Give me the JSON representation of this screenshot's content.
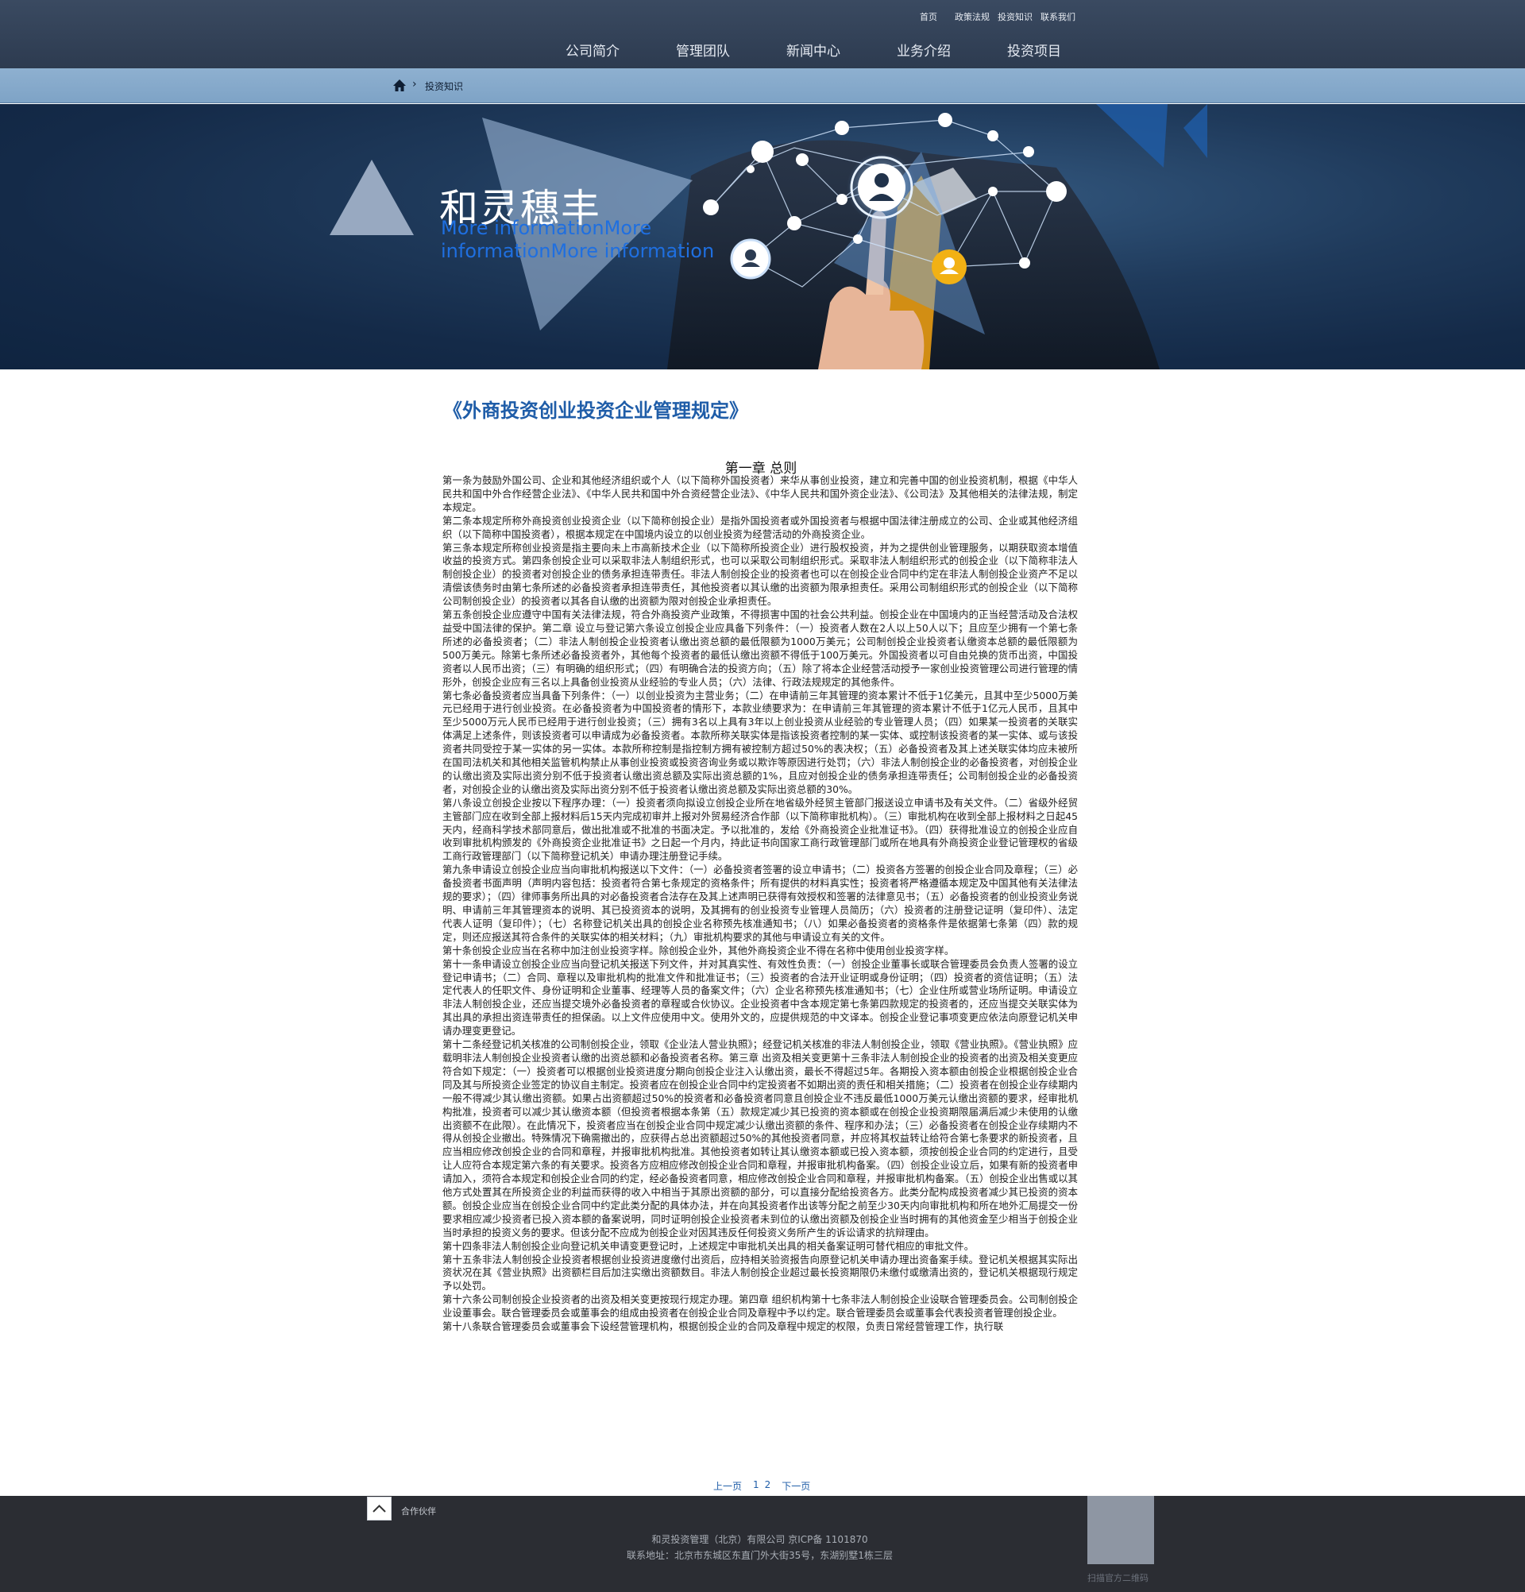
{
  "header": {
    "top_links": [
      "首页",
      "政策法规",
      "投资知识",
      "联系我们"
    ],
    "nav": [
      "公司简介",
      "管理团队",
      "新闻中心",
      "业务介绍",
      "投资项目"
    ]
  },
  "breadcrumb": {
    "current": "投资知识"
  },
  "banner": {
    "brand": "和灵穗丰",
    "subtitle": "More informationMore informationMore information"
  },
  "article": {
    "title": "《外商投资创业投资企业管理规定》",
    "chapter": "第一章 总则",
    "paragraphs": [
      "第一条为鼓励外国公司、企业和其他经济组织或个人（以下简称外国投资者）来华从事创业投资，建立和完善中国的创业投资机制，根据《中华人民共和国中外合作经营企业法》、《中华人民共和国中外合资经营企业法》、《中华人民共和国外资企业法》、《公司法》及其他相关的法律法规，制定本规定。",
      "第二条本规定所称外商投资创业投资企业（以下简称创投企业）是指外国投资者或外国投资者与根据中国法律注册成立的公司、企业或其他经济组织（以下简称中国投资者），根据本规定在中国境内设立的以创业投资为经营活动的外商投资企业。",
      "第三条本规定所称创业投资是指主要向未上市高新技术企业（以下简称所投资企业）进行股权投资，并为之提供创业管理服务，以期获取资本增值收益的投资方式。第四条创投企业可以采取非法人制组织形式，也可以采取公司制组织形式。采取非法人制组织形式的创投企业（以下简称非法人制创投企业）的投资者对创投企业的债务承担连带责任。非法人制创投企业的投资者也可以在创投企业合同中约定在非法人制创投企业资产不足以清偿该债务时由第七条所述的必备投资者承担连带责任，其他投资者以其认缴的出资额为限承担责任。采用公司制组织形式的创投企业（以下简称公司制创投企业）的投资者以其各自认缴的出资额为限对创投企业承担责任。",
      "第五条创投企业应遵守中国有关法律法规，符合外商投资产业政策，不得损害中国的社会公共利益。创投企业在中国境内的正当经营活动及合法权益受中国法律的保护。第二章 设立与登记第六条设立创投企业应具备下列条件：（一）投资者人数在2人以上50人以下；且应至少拥有一个第七条所述的必备投资者；（二）非法人制创投企业投资者认缴出资总额的最低限额为1000万美元；公司制创投企业投资者认缴资本总额的最低限额为500万美元。除第七条所述必备投资者外，其他每个投资者的最低认缴出资额不得低于100万美元。外国投资者以可自由兑换的货币出资，中国投资者以人民币出资；（三）有明确的组织形式；（四）有明确合法的投资方向；（五）除了将本企业经营活动授予一家创业投资管理公司进行管理的情形外，创投企业应有三名以上具备创业投资从业经验的专业人员；（六）法律、行政法规规定的其他条件。",
      "第七条必备投资者应当具备下列条件：（一）以创业投资为主营业务；（二）在申请前三年其管理的资本累计不低于1亿美元，且其中至少5000万美元已经用于进行创业投资。在必备投资者为中国投资者的情形下，本款业绩要求为：在申请前三年其管理的资本累计不低于1亿元人民币，且其中至少5000万元人民币已经用于进行创业投资；（三）拥有3名以上具有3年以上创业投资从业经验的专业管理人员；（四）如果某一投资者的关联实体满足上述条件，则该投资者可以申请成为必备投资者。本款所称关联实体是指该投资者控制的某一实体、或控制该投资者的某一实体、或与该投资者共同受控于某一实体的另一实体。本款所称控制是指控制方拥有被控制方超过50%的表决权；（五）必备投资者及其上述关联实体均应未被所在国司法机关和其他相关监管机构禁止从事创业投资或投资咨询业务或以欺诈等原因进行处罚；（六）非法人制创投企业的必备投资者，对创投企业的认缴出资及实际出资分别不低于投资者认缴出资总额及实际出资总额的1%，且应对创投企业的债务承担连带责任；公司制创投企业的必备投资者，对创投企业的认缴出资及实际出资分别不低于投资者认缴出资总额及实际出资总额的30%。",
      "第八条设立创投企业按以下程序办理：（一）投资者须向拟设立创投企业所在地省级外经贸主管部门报送设立申请书及有关文件。（二）省级外经贸主管部门应在收到全部上报材料后15天内完成初审并上报对外贸易经济合作部（以下简称审批机构）。（三）审批机构在收到全部上报材料之日起45天内，经商科学技术部同意后，做出批准或不批准的书面决定。予以批准的，发给《外商投资企业批准证书》。（四）获得批准设立的创投企业应自收到审批机构颁发的《外商投资企业批准证书》之日起一个月内，持此证书向国家工商行政管理部门或所在地具有外商投资企业登记管理权的省级工商行政管理部门（以下简称登记机关）申请办理注册登记手续。",
      "第九条申请设立创投企业应当向审批机构报送以下文件：（一）必备投资者签署的设立申请书；（二）投资各方签署的创投企业合同及章程；（三）必备投资者书面声明（声明内容包括：投资者符合第七条规定的资格条件；所有提供的材料真实性；投资者将严格遵循本规定及中国其他有关法律法规的要求）；（四）律师事务所出具的对必备投资者合法存在及其上述声明已获得有效授权和签署的法律意见书；（五）必备投资者的创业投资业务说明、申请前三年其管理资本的说明、其已投资资本的说明，及其拥有的创业投资专业管理人员简历；（六）投资者的注册登记证明（复印件）、法定代表人证明（复印件）；（七）名称登记机关出具的创投企业名称预先核准通知书；（八）如果必备投资者的资格条件是依据第七条第（四）款的规定，则还应报送其符合条件的关联实体的相关材料；（九）审批机构要求的其他与申请设立有关的文件。",
      "第十条创投企业应当在名称中加注创业投资字样。除创投企业外，其他外商投资企业不得在名称中使用创业投资字样。",
      "第十一条申请设立创投企业应当向登记机关报送下列文件，并对其真实性、有效性负责：（一）创投企业董事长或联合管理委员会负责人签署的设立登记申请书；（二）合同、章程以及审批机构的批准文件和批准证书；（三）投资者的合法开业证明或身份证明；（四）投资者的资信证明；（五）法定代表人的任职文件、身份证明和企业董事、经理等人员的备案文件；（六）企业名称预先核准通知书；（七）企业住所或营业场所证明。申请设立非法人制创投企业，还应当提交境外必备投资者的章程或合伙协议。企业投资者中含本规定第七条第四款规定的投资者的，还应当提交关联实体为其出具的承担出资连带责任的担保函。以上文件应使用中文。使用外文的，应提供规范的中文译本。创投企业登记事项变更应依法向原登记机关申请办理变更登记。",
      "第十二条经登记机关核准的公司制创投企业，领取《企业法人营业执照》；经登记机关核准的非法人制创投企业，领取《营业执照》。《营业执照》应载明非法人制创投企业投资者认缴的出资总额和必备投资者名称。第三章 出资及相关变更第十三条非法人制创投企业的投资者的出资及相关变更应符合如下规定：（一）投资者可以根据创业投资进度分期向创投企业注入认缴出资，最长不得超过5年。各期投入资本额由创投企业根据创投企业合同及其与所投资企业签定的协议自主制定。投资者应在创投企业合同中约定投资者不如期出资的责任和相关措施；（二）投资者在创投企业存续期内一般不得减少其认缴出资额。如果占出资额超过50%的投资者和必备投资者同意且创投企业不违反最低1000万美元认缴出资额的要求，经审批机构批准，投资者可以减少其认缴资本额（但投资者根据本条第（五）款规定减少其已投资的资本额或在创投企业投资期限届满后减少未使用的认缴出资额不在此限）。在此情况下，投资者应当在创投企业合同中规定减少认缴出资额的条件、程序和办法；（三）必备投资者在创投企业存续期内不得从创投企业撤出。特殊情况下确需撤出的，应获得占总出资额超过50%的其他投资者同意，并应将其权益转让给符合第七条要求的新投资者，且应当相应修改创投企业的合同和章程，并报审批机构批准。其他投资者如转让其认缴资本额或已投入资本额，须按创投企业合同的约定进行，且受让人应符合本规定第六条的有关要求。投资各方应相应修改创投企业合同和章程，并报审批机构备案。（四）创投企业设立后，如果有新的投资者申请加入，须符合本规定和创投企业合同的约定，经必备投资者同意，相应修改创投企业合同和章程，并报审批机构备案。（五）创投企业出售或以其他方式处置其在所投资企业的利益而获得的收入中相当于其原出资额的部分，可以直接分配给投资各方。此类分配构成投资者减少其已投资的资本额。创投企业应当在创投企业合同中约定此类分配的具体办法，并在向其投资者作出该等分配之前至少30天内向审批机构和所在地外汇局提交一份要求相应减少投资者已投入资本额的备案说明，同时证明创投企业投资者未到位的认缴出资额及创投企业当时拥有的其他资金至少相当于创投企业当时承担的投资义务的要求。但该分配不应成为创投企业对因其违反任何投资义务所产生的诉讼请求的抗辩理由。",
      "第十四条非法人制创投企业向登记机关申请变更登记时，上述规定中审批机关出具的相关备案证明可替代相应的审批文件。",
      "第十五条非法人制创投企业投资者根据创业投资进度缴付出资后，应持相关验资报告向原登记机关申请办理出资备案手续。登记机关根据其实际出资状况在其《营业执照》出资额栏目后加注实缴出资额数目。非法人制创投企业超过最长投资期限仍未缴付或缴清出资的，登记机关根据现行规定予以处罚。",
      "第十六条公司制创投企业投资者的出资及相关变更按现行规定办理。第四章 组织机构第十七条非法人制创投企业设联合管理委员会。公司制创投企业设董事会。联合管理委员会或董事会的组成由投资者在创投企业合同及章程中予以约定。联合管理委员会或董事会代表投资者管理创投企业。",
      "第十八条联合管理委员会或董事会下设经营管理机构，根据创投企业的合同及章程中规定的权限，负责日常经营管理工作，执行联"
    ]
  },
  "pager": {
    "prev": "上一页",
    "pages": [
      "1",
      "2"
    ],
    "next": "下一页"
  },
  "footer": {
    "partner_label": "合作伙伴",
    "copyright": "和灵投资管理（北京）有限公司 京ICP备 1101870",
    "address": "联系地址：北京市东城区东直门外大街35号，东湖别墅1栋三层",
    "qr_label": "扫描官方二维码"
  },
  "colors": {
    "header_bg": "#33435a",
    "crumb_bar": "#84a8ca",
    "title_blue": "#1f5da8",
    "banner_sub": "#1f6fe0",
    "footer_bg": "#2b2d33"
  }
}
